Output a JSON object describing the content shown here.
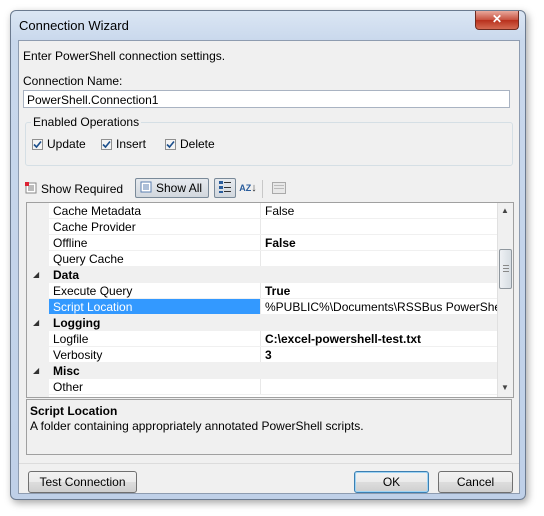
{
  "window": {
    "title": "Connection Wizard",
    "close_glyph": "✕"
  },
  "intro_text": "Enter PowerShell connection settings.",
  "connection_name": {
    "label": "Connection Name:",
    "value": "PowerShell.Connection1"
  },
  "enabled_operations": {
    "legend": "Enabled Operations",
    "items": [
      {
        "label": "Update",
        "checked": true
      },
      {
        "label": "Insert",
        "checked": true
      },
      {
        "label": "Delete",
        "checked": true
      }
    ]
  },
  "toolbar": {
    "show_required": "Show Required",
    "show_all": "Show All",
    "az_label": "AZ"
  },
  "properties": [
    {
      "type": "prop",
      "name": "Cache Metadata",
      "value": "False",
      "bold": false
    },
    {
      "type": "prop",
      "name": "Cache Provider",
      "value": "",
      "bold": false
    },
    {
      "type": "prop",
      "name": "Offline",
      "value": "False",
      "bold": true
    },
    {
      "type": "prop",
      "name": "Query Cache",
      "value": "",
      "bold": false
    },
    {
      "type": "category",
      "name": "Data"
    },
    {
      "type": "prop",
      "name": "Execute Query",
      "value": "True",
      "bold": true
    },
    {
      "type": "prop",
      "name": "Script Location",
      "value": "%PUBLIC%\\Documents\\RSSBus PowerShell Scripts",
      "bold": false,
      "selected": true
    },
    {
      "type": "category",
      "name": "Logging"
    },
    {
      "type": "prop",
      "name": "Logfile",
      "value": "C:\\excel-powershell-test.txt",
      "bold": true
    },
    {
      "type": "prop",
      "name": "Verbosity",
      "value": "3",
      "bold": true
    },
    {
      "type": "category",
      "name": "Misc"
    },
    {
      "type": "prop",
      "name": "Other",
      "value": "",
      "bold": false
    }
  ],
  "description": {
    "title": "Script Location",
    "text": "A folder containing appropriately annotated PowerShell scripts."
  },
  "buttons": {
    "test_connection": "Test Connection",
    "ok": "OK",
    "cancel": "Cancel"
  },
  "colors": {
    "selection": "#3399ff",
    "window_frame": "#bfd0e8",
    "close_button": "#c7503e"
  }
}
